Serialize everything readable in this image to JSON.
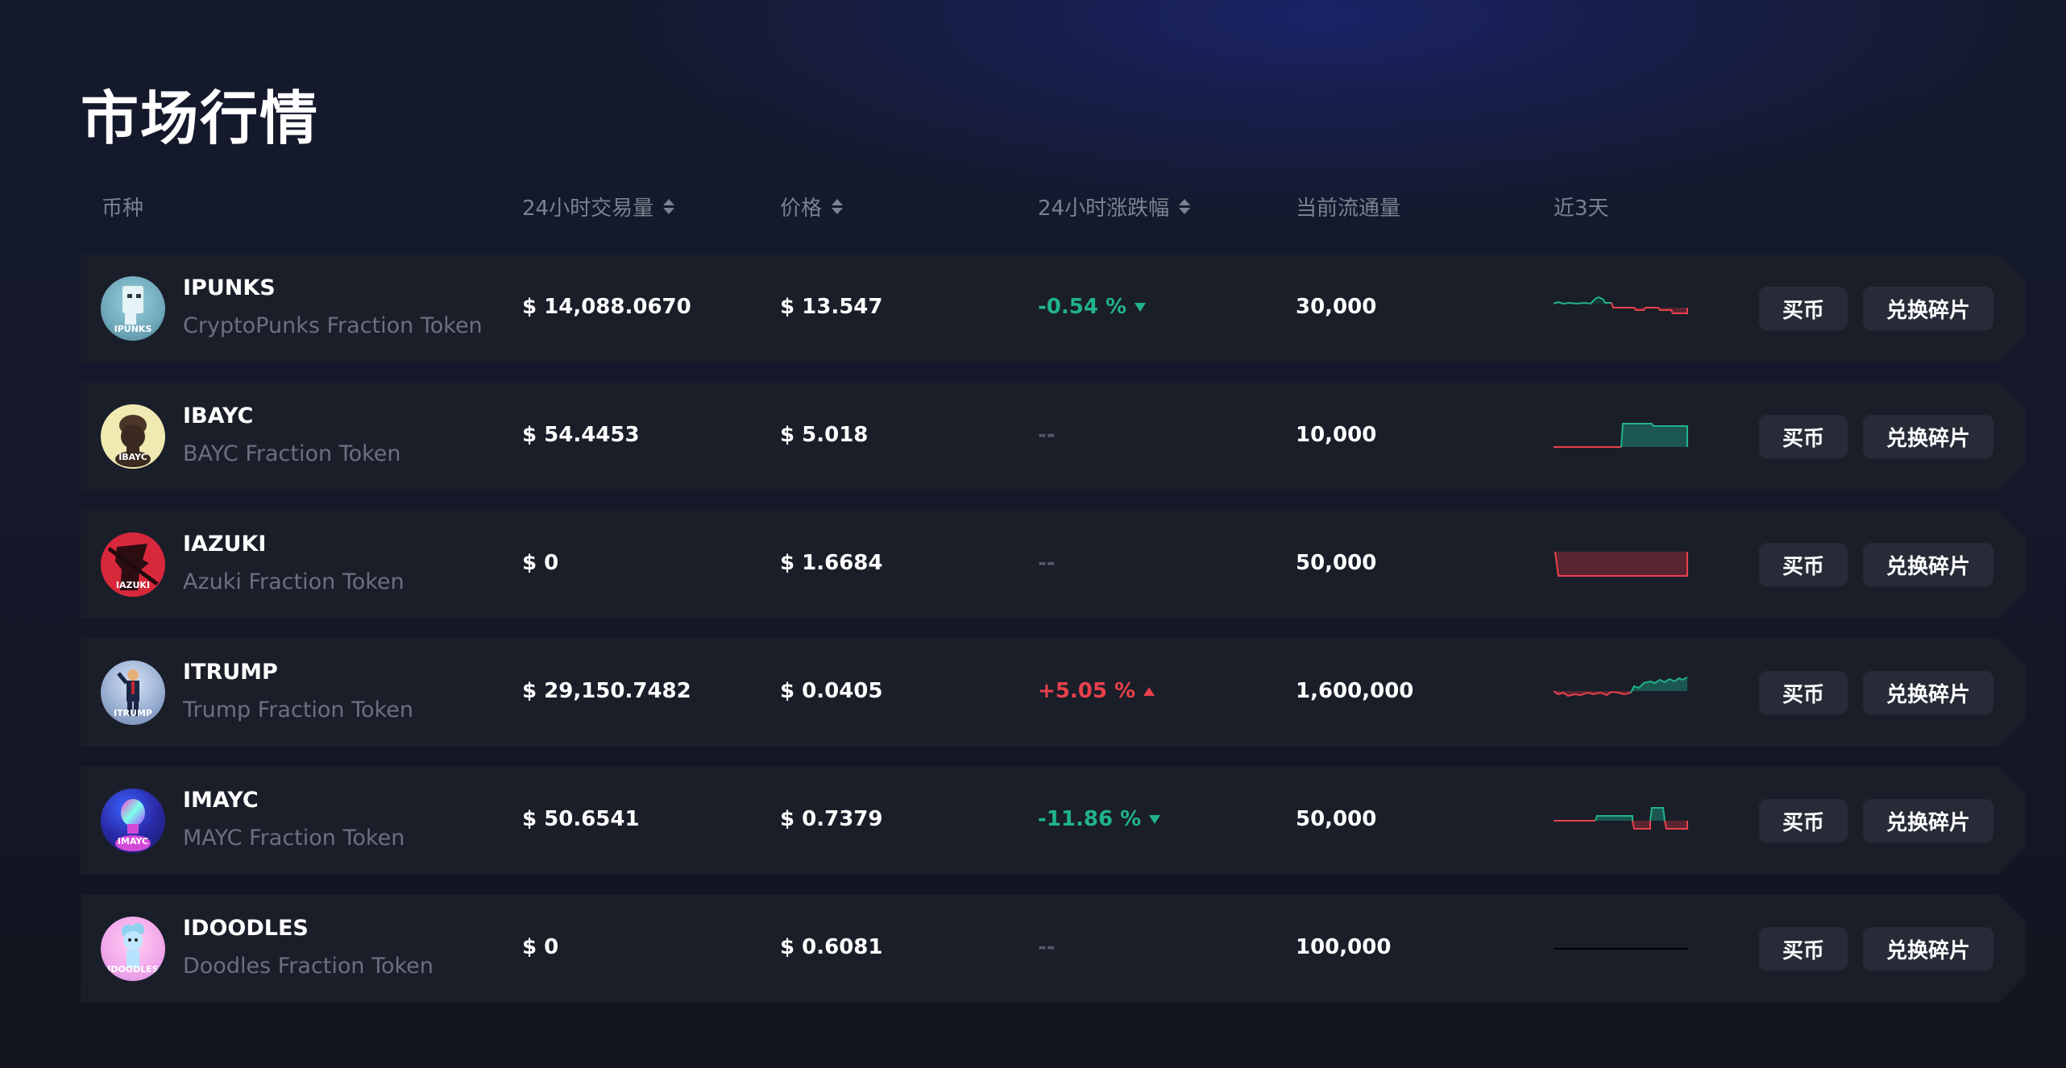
{
  "page": {
    "title": "市场行情"
  },
  "columns": {
    "coin": "币种",
    "volume": "24小时交易量",
    "price": "价格",
    "change": "24小时涨跌幅",
    "circulation": "当前流通量",
    "trend": "近3天"
  },
  "actions": {
    "buy": "买币",
    "swap": "兑换碎片"
  },
  "colors": {
    "up": "#e8414c",
    "down": "#21b38a",
    "row_bg": "#1a1e29",
    "button_bg": "#262b37"
  },
  "rows": [
    {
      "symbol": "IPUNKS",
      "name": "CryptoPunks Fraction Token",
      "avatar_label": "IPUNKS",
      "volume": "$ 14,088.0670",
      "price": "$ 13.547",
      "change": "-0.54 %",
      "change_dir": "down",
      "circulation": "30,000"
    },
    {
      "symbol": "IBAYC",
      "name": "BAYC Fraction Token",
      "avatar_label": "IBAYC",
      "volume": "$ 54.4453",
      "price": "$ 5.018",
      "change": "--",
      "change_dir": "none",
      "circulation": "10,000"
    },
    {
      "symbol": "IAZUKI",
      "name": "Azuki Fraction Token",
      "avatar_label": "IAZUKI",
      "volume": "$ 0",
      "price": "$ 1.6684",
      "change": "--",
      "change_dir": "none",
      "circulation": "50,000"
    },
    {
      "symbol": "ITRUMP",
      "name": "Trump Fraction Token",
      "avatar_label": "ITRUMP",
      "volume": "$ 29,150.7482",
      "price": "$ 0.0405",
      "change": "+5.05 %",
      "change_dir": "up",
      "circulation": "1,600,000"
    },
    {
      "symbol": "IMAYC",
      "name": "MAYC Fraction Token",
      "avatar_label": "IMAYC",
      "volume": "$ 50.6541",
      "price": "$ 0.7379",
      "change": "-11.86 %",
      "change_dir": "down",
      "circulation": "50,000"
    },
    {
      "symbol": "IDOODLES",
      "name": "Doodles Fraction Token",
      "avatar_label": "IDOODLES",
      "volume": "$ 0",
      "price": "$ 0.6081",
      "change": "--",
      "change_dir": "none",
      "circulation": "100,000"
    }
  ]
}
